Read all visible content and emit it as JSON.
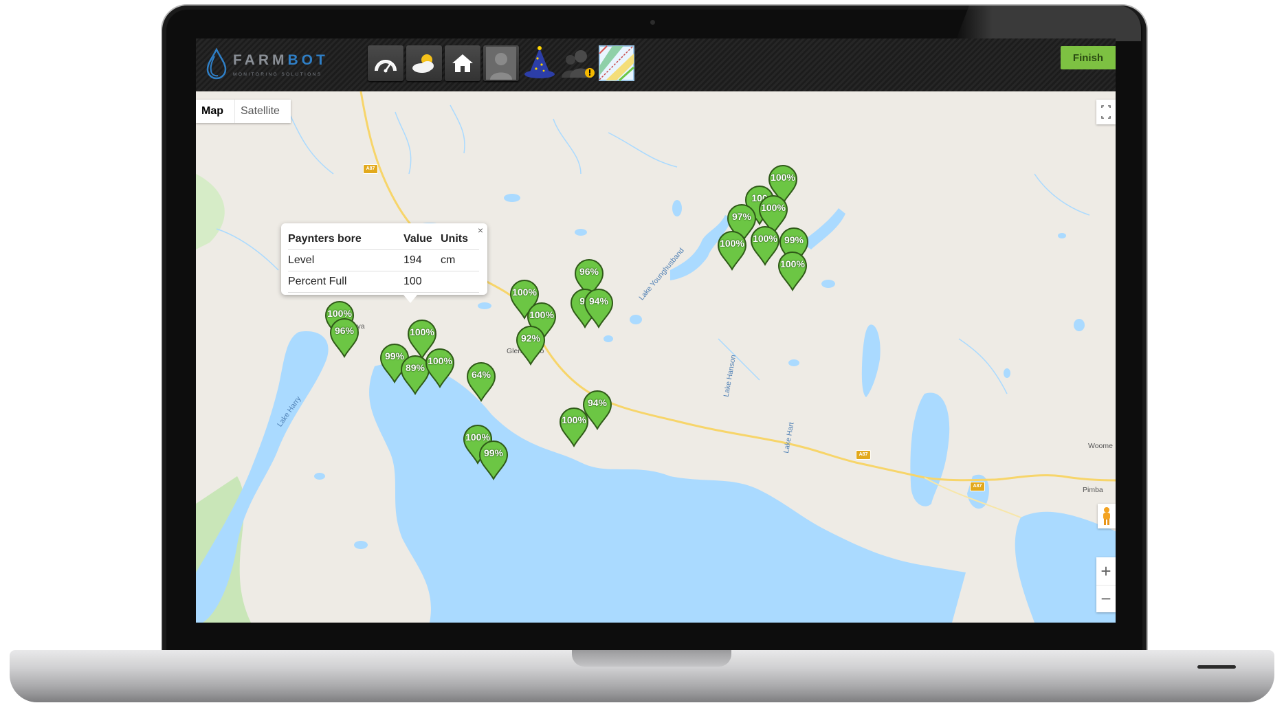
{
  "app": {
    "logo_primary": "FARM",
    "logo_accent": "BOT",
    "logo_tagline": "MONITORING SOLUTIONS"
  },
  "toolbar": {
    "icons": [
      "dashboard-gauge-icon",
      "weather-icon",
      "home-icon",
      "user-profile-icon",
      "wizard-hat-icon",
      "user-alert-icon",
      "map-icon"
    ],
    "finish_label": "Finish"
  },
  "map": {
    "type_buttons": [
      "Map",
      "Satellite"
    ],
    "selected_type": "Map",
    "zoom_in": "+",
    "zoom_out": "−",
    "place_labels": [
      "Kingoonya",
      "Glendambo",
      "Woome",
      "Pimba"
    ],
    "lake_labels": [
      "Lake Harry",
      "Lake Younghusband",
      "Lake Hanson",
      "Lake Hart"
    ],
    "road_shields": [
      "A87",
      "A87",
      "A87"
    ]
  },
  "info_window": {
    "close": "×",
    "header": {
      "name": "Paynters bore",
      "value": "Value",
      "units": "Units"
    },
    "rows": [
      {
        "name": "Level",
        "value": "194",
        "units": "cm"
      },
      {
        "name": "Percent Full",
        "value": "100",
        "units": ""
      }
    ]
  },
  "markers": [
    {
      "label": "100%"
    },
    {
      "label": "100"
    },
    {
      "label": "97%"
    },
    {
      "label": "100%"
    },
    {
      "label": "100%"
    },
    {
      "label": "100%"
    },
    {
      "label": "99%"
    },
    {
      "label": "100%"
    },
    {
      "label": "96%"
    },
    {
      "label": "97"
    },
    {
      "label": "94%"
    },
    {
      "label": "100%"
    },
    {
      "label": "100%"
    },
    {
      "label": "92%"
    },
    {
      "label": "100%"
    },
    {
      "label": "96%"
    },
    {
      "label": "100%"
    },
    {
      "label": "99%"
    },
    {
      "label": "89%"
    },
    {
      "label": "100%"
    },
    {
      "label": "64%"
    },
    {
      "label": "94%"
    },
    {
      "label": "100%"
    },
    {
      "label": "100%"
    },
    {
      "label": "99%"
    }
  ],
  "colors": {
    "marker_green": "#6cc644",
    "finish_green": "#7dc142",
    "water_blue": "#aadaff",
    "land": "#eeebe5",
    "road": "#f7d56a"
  }
}
